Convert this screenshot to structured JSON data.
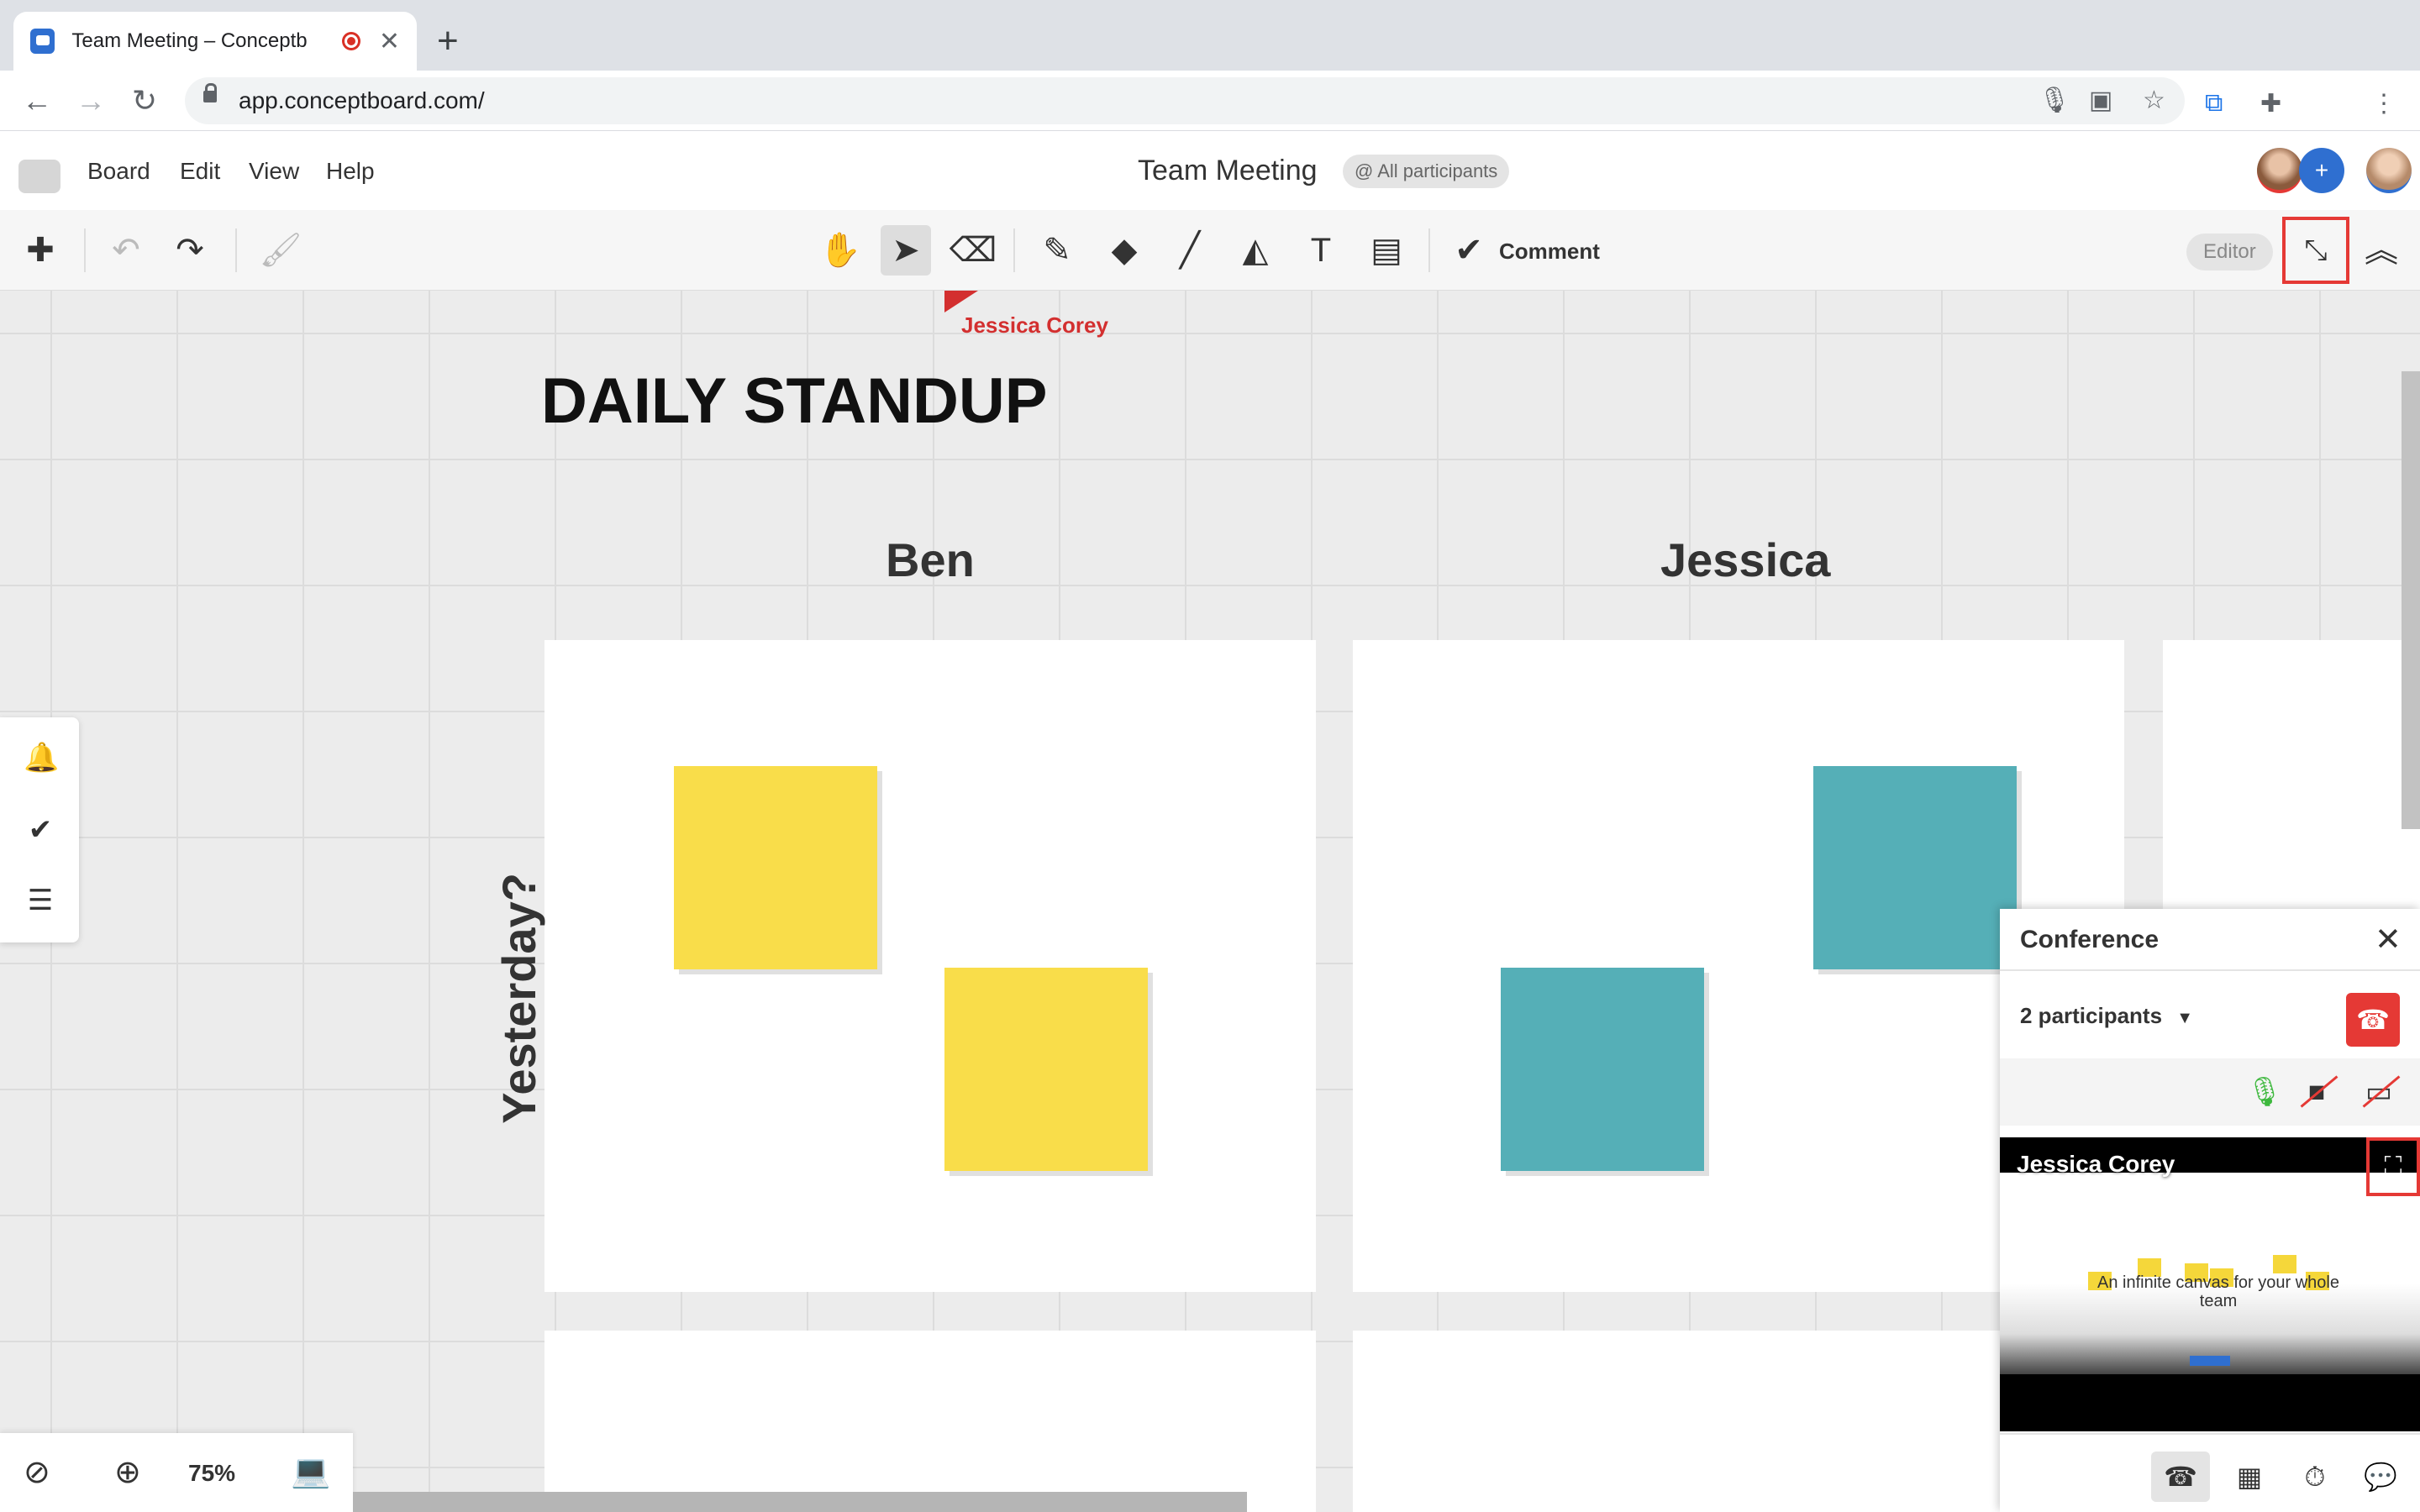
{
  "browser": {
    "tab_title": "Team Meeting – Conceptb",
    "tab_close": "✕",
    "new_tab": "+",
    "url": "app.conceptboard.com/"
  },
  "app": {
    "menu": [
      "Board",
      "Edit",
      "View",
      "Help"
    ],
    "board_title": "Team Meeting",
    "all_participants": "@ All participants",
    "toolbar": {
      "comment_label": "Comment",
      "editor_badge": "Editor"
    }
  },
  "canvas": {
    "cursor_user": "Jessica Corey",
    "heading": "DAILY STANDUP",
    "columns": [
      "Ben",
      "Jessica"
    ],
    "row_label": "Yesterday?"
  },
  "zoom": {
    "value": "75%"
  },
  "conference": {
    "title": "Conference",
    "participants": "2 participants",
    "video_user": "Jessica Corey",
    "video_headline": "An infinite canvas for your whole team"
  },
  "colors": {
    "sticky_yellow": "#f9dd4a",
    "sticky_teal": "#55afb7",
    "accent_red": "#e53935",
    "mic_green": "#3db83d"
  }
}
